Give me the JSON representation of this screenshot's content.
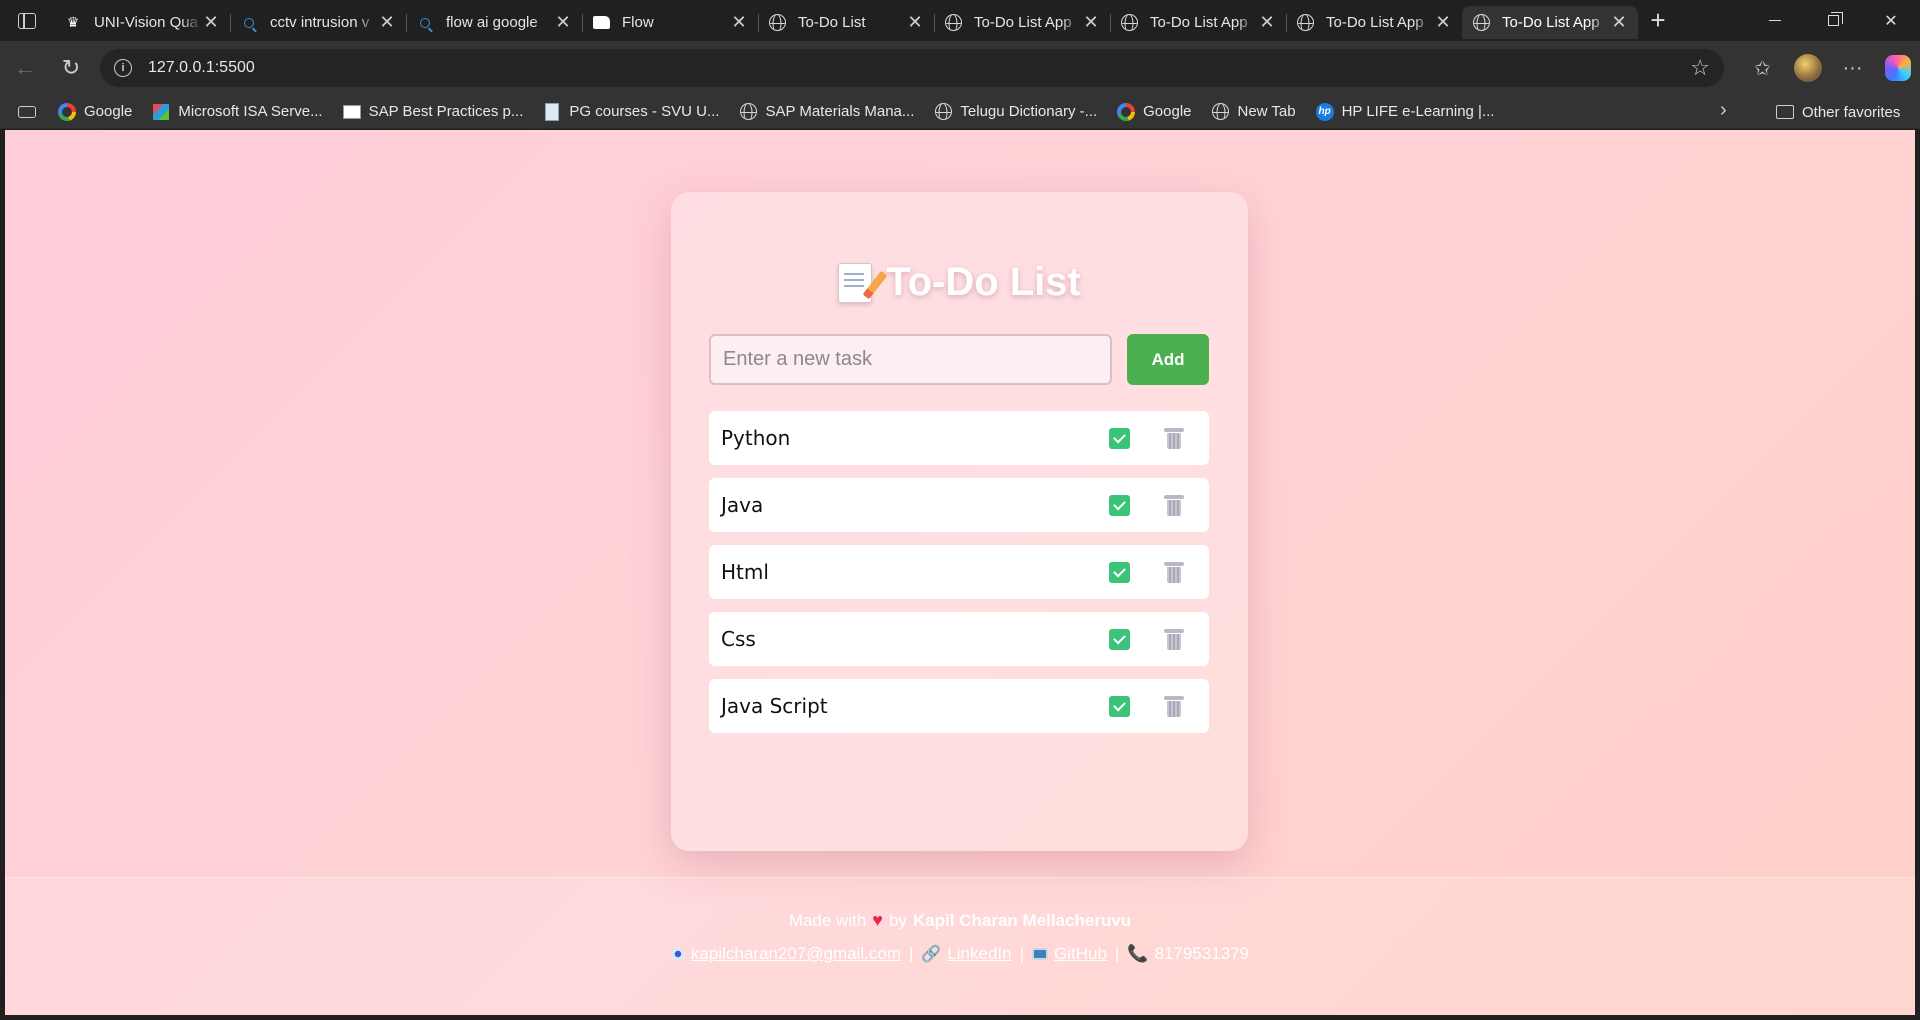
{
  "browser": {
    "tabs": [
      {
        "title": "UNI-Vision Qua",
        "icon": "crown-icon",
        "active": false
      },
      {
        "title": "cctv intrusion v",
        "icon": "search-icon",
        "active": false
      },
      {
        "title": "flow ai google",
        "icon": "search-icon",
        "active": false
      },
      {
        "title": "Flow",
        "icon": "flow-icon",
        "active": false
      },
      {
        "title": "To-Do List",
        "icon": "globe-icon",
        "active": false
      },
      {
        "title": "To-Do List App",
        "icon": "globe-icon",
        "active": false
      },
      {
        "title": "To-Do List App",
        "icon": "globe-icon",
        "active": false
      },
      {
        "title": "To-Do List App",
        "icon": "globe-icon",
        "active": false
      },
      {
        "title": "To-Do List App",
        "icon": "globe-icon",
        "active": true
      }
    ],
    "url": "127.0.0.1:5500",
    "bookmarks": [
      {
        "label": "Google",
        "icon": "google-icon"
      },
      {
        "label": "Microsoft ISA Serve...",
        "icon": "microsoft-icon"
      },
      {
        "label": "SAP Best Practices p...",
        "icon": "sap-icon"
      },
      {
        "label": "PG courses - SVU U...",
        "icon": "document-icon"
      },
      {
        "label": "SAP Materials Mana...",
        "icon": "globe-icon"
      },
      {
        "label": "Telugu Dictionary -...",
        "icon": "globe-icon"
      },
      {
        "label": "Google",
        "icon": "google-icon"
      },
      {
        "label": "New Tab",
        "icon": "globe-icon"
      },
      {
        "label": "HP LIFE e-Learning |...",
        "icon": "hp-icon"
      }
    ],
    "other_favorites": "Other favorites"
  },
  "app": {
    "title": "To-Do List",
    "title_icon": "memo-icon",
    "input_placeholder": "Enter a new task",
    "input_value": "",
    "add_label": "Add",
    "tasks": [
      {
        "label": "Python",
        "done": true
      },
      {
        "label": "Java",
        "done": true
      },
      {
        "label": "Html",
        "done": true
      },
      {
        "label": "Css",
        "done": true
      },
      {
        "label": "Java Script",
        "done": true
      }
    ]
  },
  "footer": {
    "made_with": "Made with",
    "by": "by",
    "author": "Kapil Charan Mellacheruvu",
    "email": "kapilcharan207@gmail.com",
    "linkedin": "LinkedIn",
    "github": "GitHub",
    "phone": "8179531379",
    "separator": "|"
  },
  "colors": {
    "add_button": "#4caf50",
    "check": "#3cc37a",
    "page_bg": "#ffd0d6"
  }
}
